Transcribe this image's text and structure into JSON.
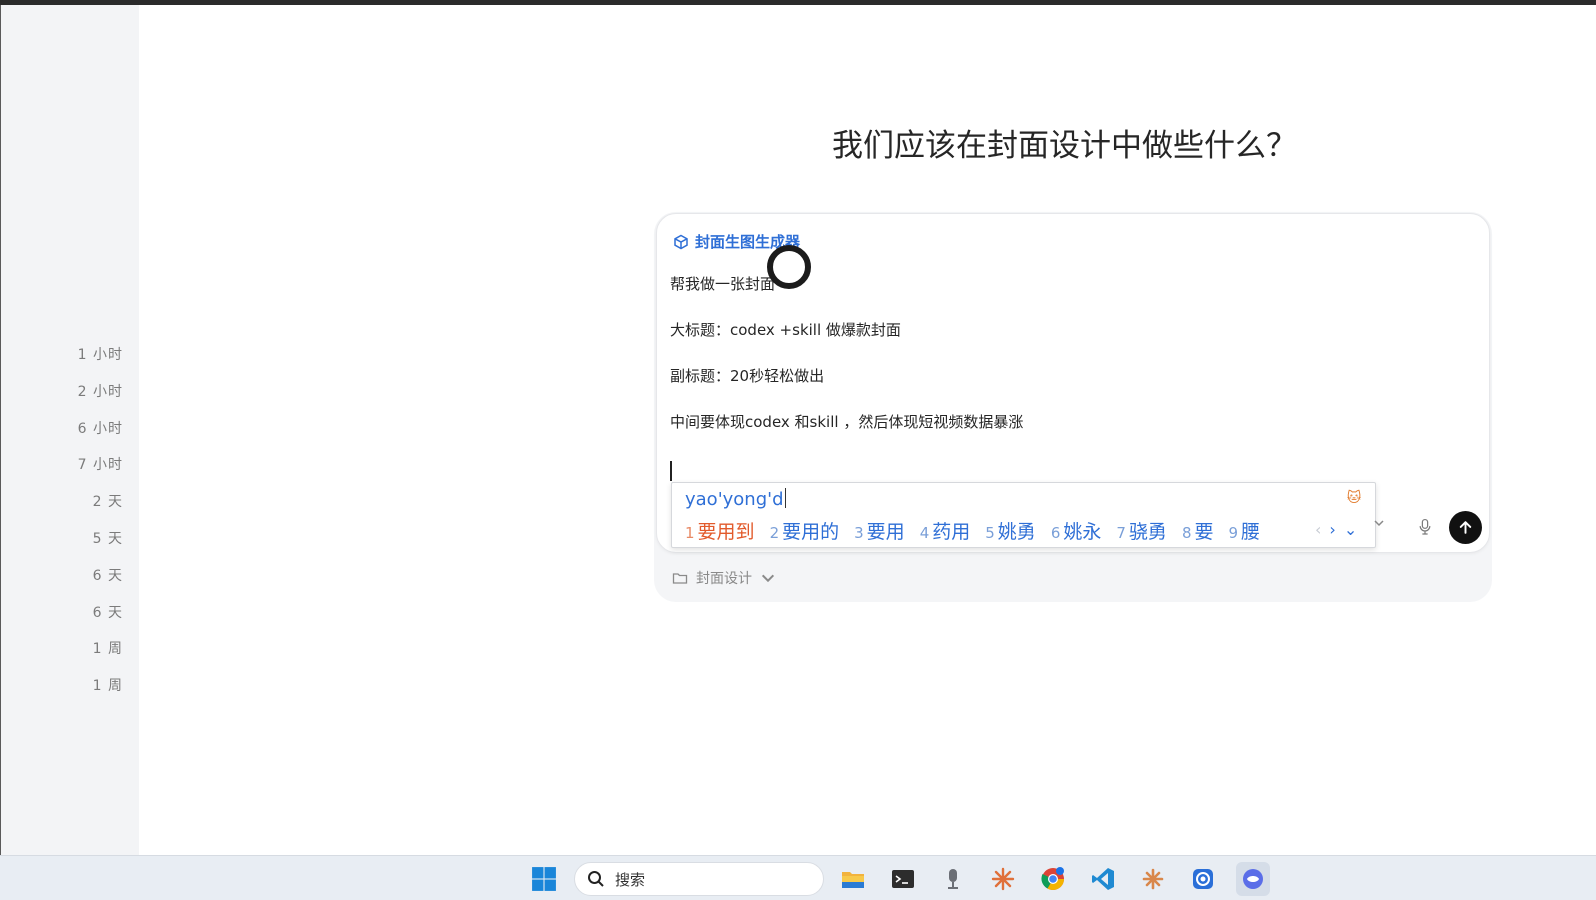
{
  "sidebar": {
    "times": [
      "1 小时",
      "2 小时",
      "6 小时",
      "7 小时",
      "2 天",
      "5 天",
      "6 天",
      "6 天",
      "1 周",
      "1 周"
    ]
  },
  "main": {
    "title": "我们应该在封面设计中做些什么？"
  },
  "composer": {
    "skill_label": "封面生图生成器",
    "lines": [
      "帮我做一张封面",
      "大标题：codex +skill 做爆款封面",
      "副标题：20秒轻松做出",
      "中间要体现codex 和skill ，然后体现短视频数据暴涨"
    ],
    "project_label": "封面设计"
  },
  "ime": {
    "input": "yao'yong'd",
    "candidates": [
      {
        "num": "1",
        "text": "要用到"
      },
      {
        "num": "2",
        "text": "要用的"
      },
      {
        "num": "3",
        "text": "要用"
      },
      {
        "num": "4",
        "text": "药用"
      },
      {
        "num": "5",
        "text": "姚勇"
      },
      {
        "num": "6",
        "text": "姚永"
      },
      {
        "num": "7",
        "text": "骁勇"
      },
      {
        "num": "8",
        "text": "要"
      },
      {
        "num": "9",
        "text": "腰"
      }
    ],
    "nav": {
      "prev": "‹",
      "next": "›",
      "expand": "⌄"
    }
  },
  "taskbar": {
    "search_label": "搜索"
  },
  "colors": {
    "accent_blue": "#2f6fd6",
    "first_candidate": "#e25a2b",
    "send_button": "#111111"
  }
}
